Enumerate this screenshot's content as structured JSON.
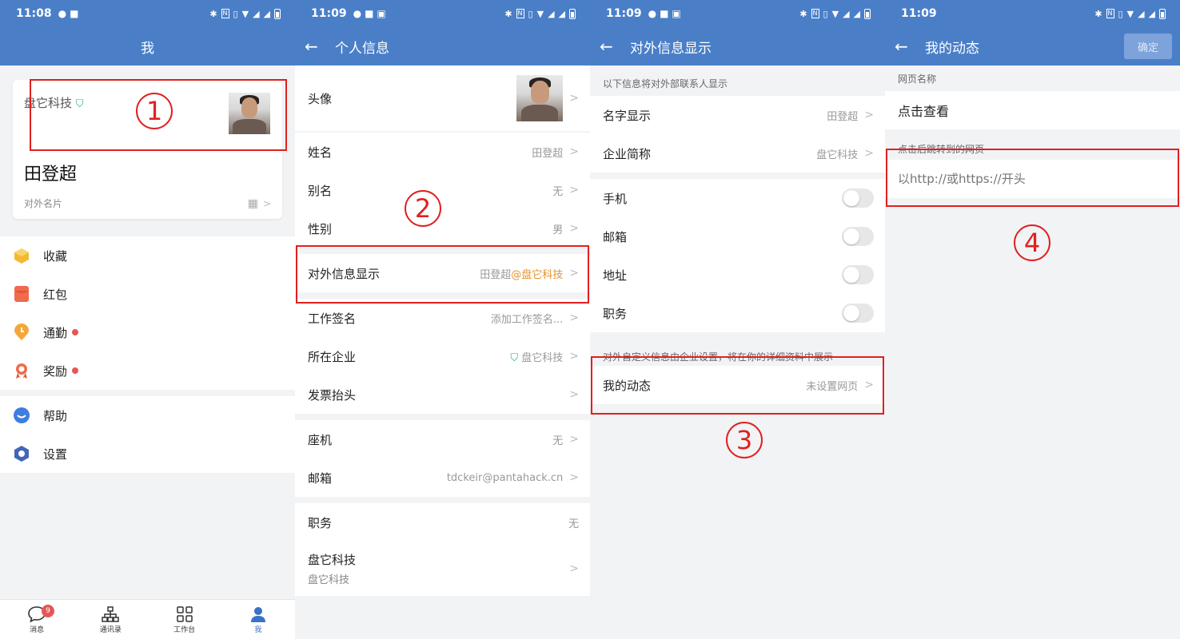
{
  "status": {
    "p1_time": "11:08",
    "p2_time": "11:09",
    "p3_time": "11:09",
    "p4_time": "11:09",
    "nfc": "N",
    "hd": "VoLTE",
    "net": "2G 4G"
  },
  "p1": {
    "title": "我",
    "company": "盘它科技",
    "name": "田登超",
    "card_label": "对外名片",
    "menu1": [
      {
        "icon": "box-icon",
        "label": "收藏",
        "dot": false
      },
      {
        "icon": "red-envelope-icon",
        "label": "红包",
        "dot": false
      },
      {
        "icon": "clock-pin-icon",
        "label": "通勤",
        "dot": true
      },
      {
        "icon": "award-icon",
        "label": "奖励",
        "dot": true
      }
    ],
    "menu2": [
      {
        "icon": "help-chat-icon",
        "label": "帮助"
      },
      {
        "icon": "settings-hex-icon",
        "label": "设置"
      }
    ],
    "tabs": [
      {
        "label": "消息",
        "badge": "9"
      },
      {
        "label": "通讯录"
      },
      {
        "label": "工作台"
      },
      {
        "label": "我"
      }
    ],
    "marker": "1"
  },
  "p2": {
    "title": "个人信息",
    "avatar_label": "头像",
    "rows1": [
      {
        "label": "姓名",
        "value": "田登超"
      },
      {
        "label": "别名",
        "value": "无"
      },
      {
        "label": "性别",
        "value": "男"
      }
    ],
    "external_label": "对外信息显示",
    "external_value_name": "田登超",
    "external_value_company": "@盘它科技",
    "rows2": [
      {
        "label": "工作签名",
        "value": "添加工作签名..."
      },
      {
        "label": "所在企业",
        "value": "盘它科技"
      },
      {
        "label": "发票抬头",
        "value": ""
      }
    ],
    "rows3": [
      {
        "label": "座机",
        "value": "无"
      },
      {
        "label": "邮箱",
        "value": "tdckeir@pantahack.cn"
      }
    ],
    "position_label": "职务",
    "position_value": "无",
    "dept_label": "盘它科技",
    "dept_sub": "盘它科技",
    "marker": "2"
  },
  "p3": {
    "title": "对外信息显示",
    "note1": "以下信息将对外部联系人显示",
    "rows1": [
      {
        "label": "名字显示",
        "value": "田登超"
      },
      {
        "label": "企业简称",
        "value": "盘它科技"
      }
    ],
    "toggles": [
      {
        "label": "手机",
        "on": false
      },
      {
        "label": "邮箱",
        "on": false
      },
      {
        "label": "地址",
        "on": false
      },
      {
        "label": "职务",
        "on": false
      }
    ],
    "note2": "对外自定义信息由企业设置，将在你的详细资料中展示",
    "moment_label": "我的动态",
    "moment_value": "未设置网页",
    "marker": "3"
  },
  "p4": {
    "title": "我的动态",
    "confirm": "确定",
    "name_label": "网页名称",
    "name_value": "点击查看",
    "url_label": "点击后跳转到的网页",
    "url_placeholder": "以http://或https://开头",
    "marker": "4"
  }
}
